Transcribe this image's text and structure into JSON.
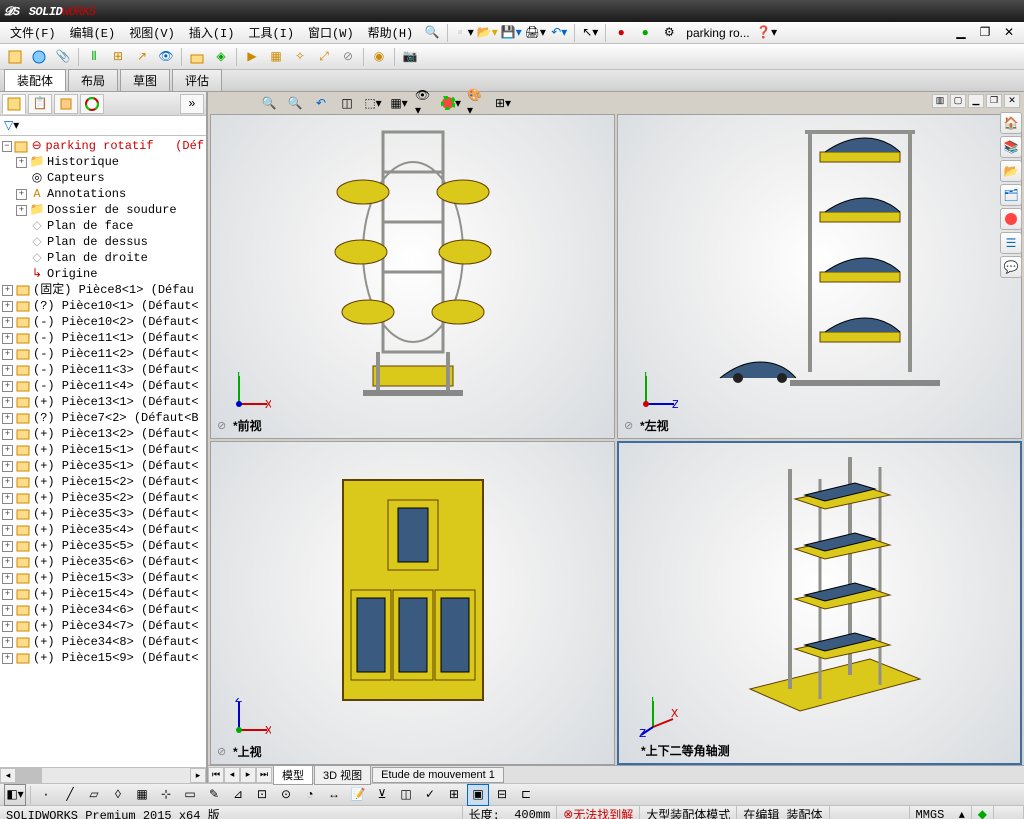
{
  "app": {
    "brand_s": "SOLID",
    "brand_w": "WORKS"
  },
  "menus": {
    "file": "文件(F)",
    "edit": "编辑(E)",
    "view": "视图(V)",
    "insert": "插入(I)",
    "tools": "工具(I)",
    "window": "窗口(W)",
    "help": "帮助(H)",
    "doc_label": "parking ro..."
  },
  "panel_tabs": {
    "assembly": "装配体",
    "layout": "布局",
    "sketch": "草图",
    "evaluate": "评估"
  },
  "tree": {
    "root": "parking rotatif",
    "root_suffix": "(Déf",
    "history": "Historique",
    "sensors": "Capteurs",
    "annotations": "Annotations",
    "weldfolder": "Dossier de soudure",
    "plane_front": "Plan de face",
    "plane_top": "Plan de dessus",
    "plane_right": "Plan de droite",
    "origin": "Origine",
    "parts": [
      "(固定) Pièce8<1> (Défau",
      "(?) Pièce10<1> (Défaut<",
      "(-) Pièce10<2> (Défaut<",
      "(-) Pièce11<1> (Défaut<",
      "(-) Pièce11<2> (Défaut<",
      "(-) Pièce11<3> (Défaut<",
      "(-) Pièce11<4> (Défaut<",
      "(+) Pièce13<1> (Défaut<",
      "(?) Pièce7<2> (Défaut<B",
      "(+) Pièce13<2> (Défaut<",
      "(+) Pièce15<1> (Défaut<",
      "(+) Pièce35<1> (Défaut<",
      "(+) Pièce15<2> (Défaut<",
      "(+) Pièce35<2> (Défaut<",
      "(+) Pièce35<3> (Défaut<",
      "(+) Pièce35<4> (Défaut<",
      "(+) Pièce35<5> (Défaut<",
      "(+) Pièce35<6> (Défaut<",
      "(+) Pièce15<3> (Défaut<",
      "(+) Pièce15<4> (Défaut<",
      "(+) Pièce34<6> (Défaut<",
      "(+) Pièce34<7> (Défaut<",
      "(+) Pièce34<8> (Défaut<",
      "(+) Pièce15<9> (Défaut<"
    ]
  },
  "viewports": {
    "front": "*前视",
    "left": "*左视",
    "top": "*上视",
    "iso": "*上下二等角轴测"
  },
  "bottom_tabs": {
    "model": "模型",
    "view3d": "3D 视图",
    "motion": "Etude de mouvement 1"
  },
  "status": {
    "product": "SOLIDWORKS Premium 2015 x64 版",
    "length_label": "长度:",
    "length_value": "400mm",
    "error": "无法找到解",
    "mode": "大型装配体模式",
    "editing": "在编辑 装配体",
    "units": "MMGS"
  },
  "colors": {
    "frame": "#90908c",
    "platform": "#dac81a",
    "car": "#3a5a80",
    "accent_red": "#c00",
    "accent_green": "#0a0",
    "accent_blue": "#00c"
  }
}
